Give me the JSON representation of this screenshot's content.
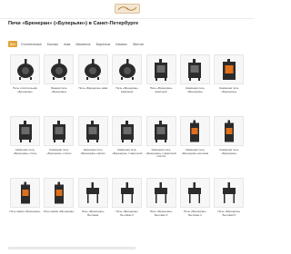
{
  "header": {
    "logo_text": "Бренеран"
  },
  "page_title": "Печи «Бренеран» («Булерьян») в Санкт-Петербурге",
  "tabs": [
    {
      "label": "Все",
      "active": true
    },
    {
      "label": "Отопительные",
      "active": false
    },
    {
      "label": "Банные",
      "active": false
    },
    {
      "label": "Аква",
      "active": false
    },
    {
      "label": "Каминные",
      "active": false
    },
    {
      "label": "Варочные",
      "active": false
    },
    {
      "label": "Камины",
      "active": false
    },
    {
      "label": "Фантом",
      "active": false
    }
  ],
  "products": [
    {
      "name": "Печь отопительная «Бренеран»",
      "icon": "barrel-stove-icon"
    },
    {
      "name": "Банная печь «Бренеран»",
      "icon": "barrel-stove-icon"
    },
    {
      "name": "Печь «Бренеран» аква",
      "icon": "barrel-stove-icon"
    },
    {
      "name": "Печь «Бренеран» каминная",
      "icon": "barrel-stove-icon"
    },
    {
      "name": "Печь «Бренеран» варочная",
      "icon": "box-stove-icon"
    },
    {
      "name": "Каминная печь «Бренеран»",
      "icon": "box-stove-icon"
    },
    {
      "name": "Каминная печь «Бренеран»",
      "icon": "fireplace-stove-icon"
    },
    {
      "name": "Каминная печь «Бренеран» сталь",
      "icon": "box-stove-icon"
    },
    {
      "name": "Каминная печь «Бренеран» стекло",
      "icon": "box-stove-icon"
    },
    {
      "name": "Каминная печь «Бренеран» кирпич",
      "icon": "box-stove-icon"
    },
    {
      "name": "Каминная печь «Бренеран» с варочной",
      "icon": "box-stove-icon"
    },
    {
      "name": "Каминная печь «Бренеран» с варочной плитой",
      "icon": "box-stove-icon"
    },
    {
      "name": "Каминная печь «Бренеран» высокая",
      "icon": "tall-stove-icon"
    },
    {
      "name": "Каминная печь «Бренеран»",
      "icon": "tall-stove-icon"
    },
    {
      "name": "Печь камин «Бренеран»",
      "icon": "tall-stove-icon"
    },
    {
      "name": "Печь камин «Бренеран»",
      "icon": "tall-stove-icon"
    },
    {
      "name": "Печь «Бренеран» Бытовая",
      "icon": "stool-stove-icon"
    },
    {
      "name": "Печь «Бренеран» Бытовая 2",
      "icon": "stool-stove-icon"
    },
    {
      "name": "Печь «Бренеран» Бытовая 3",
      "icon": "stool-stove-icon"
    },
    {
      "name": "Печь «Бренеран» Бытовая 4",
      "icon": "stool-stove-icon"
    },
    {
      "name": "Печь «Бренеран» Бытовая 5",
      "icon": "stool-stove-icon"
    }
  ],
  "colors": {
    "accent": "#e2a33a",
    "stove_dark": "#2b2b2b",
    "fire": "#e0701c"
  }
}
